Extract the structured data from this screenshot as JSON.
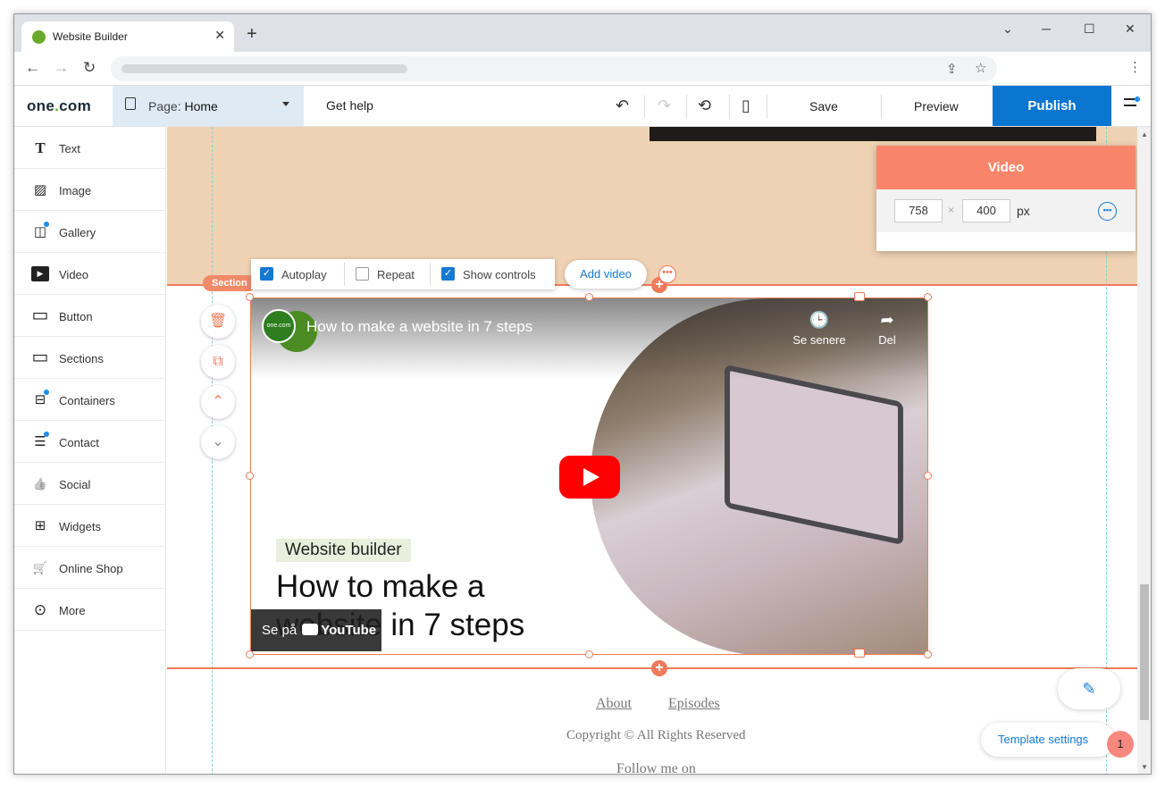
{
  "browser": {
    "tab_title": "Website Builder",
    "new_tab": "+",
    "tab_close": "✕",
    "win_min": "─",
    "win_max": "☐",
    "win_close": "✕",
    "win_dropdown": "⌄"
  },
  "header": {
    "logo_prefix": "one",
    "logo_dot": ".",
    "logo_suffix": "com",
    "page_prefix": "Page: ",
    "page_name": "Home",
    "get_help": "Get help",
    "save": "Save",
    "preview": "Preview",
    "publish": "Publish",
    "publish_color": "#0a76d0"
  },
  "sidebar": {
    "items": [
      {
        "label": "Text",
        "icon": "text-icon",
        "glyph": "T"
      },
      {
        "label": "Image",
        "icon": "image-icon",
        "glyph": "▨"
      },
      {
        "label": "Gallery",
        "icon": "gallery-icon",
        "glyph": "◫"
      },
      {
        "label": "Video",
        "icon": "video-icon",
        "glyph": "▶"
      },
      {
        "label": "Button",
        "icon": "button-icon",
        "glyph": "▭"
      },
      {
        "label": "Sections",
        "icon": "sections-icon",
        "glyph": "▭"
      },
      {
        "label": "Containers",
        "icon": "containers-icon",
        "glyph": "⊟"
      },
      {
        "label": "Contact",
        "icon": "contact-icon",
        "glyph": "☰"
      },
      {
        "label": "Social",
        "icon": "social-icon",
        "glyph": "👍"
      },
      {
        "label": "Widgets",
        "icon": "widgets-icon",
        "glyph": "⊞"
      },
      {
        "label": "Online Shop",
        "icon": "cart-icon",
        "glyph": "🛒"
      },
      {
        "label": "More",
        "icon": "more-icon",
        "glyph": "⊙"
      }
    ]
  },
  "canvas": {
    "section_label": "Section",
    "toolbar": {
      "autoplay": "Autoplay",
      "repeat": "Repeat",
      "show_controls": "Show controls",
      "autoplay_checked": true,
      "repeat_checked": false,
      "show_controls_checked": true
    },
    "add_video": "Add video",
    "video": {
      "title": "How to make a website in 7 steps",
      "channel": "one.com",
      "watch_later": "Se senere",
      "share": "Del",
      "tag": "Website builder",
      "headline": "How to make a website in 7 steps",
      "watch_on": "Se på",
      "youtube": "YouTube"
    },
    "footer": {
      "about": "About",
      "episodes": "Episodes",
      "copyright": "Copyright © All Rights Reserved",
      "follow": "Follow me on"
    },
    "template_settings": "Template settings",
    "template_badge": "1"
  },
  "video_panel": {
    "title": "Video",
    "width": "758",
    "height": "400",
    "times": "×",
    "unit": "px"
  }
}
